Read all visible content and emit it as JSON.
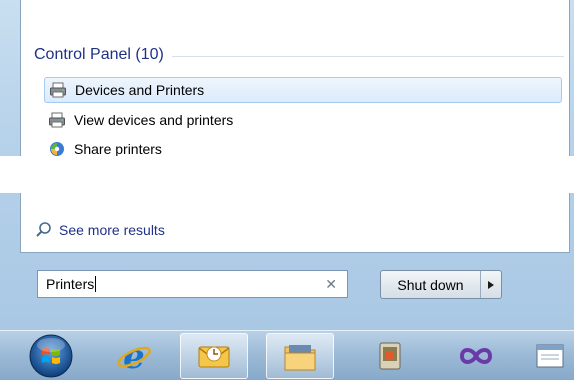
{
  "start_menu": {
    "group": {
      "title": "Control Panel (10)"
    },
    "results": [
      {
        "label": "Devices and Printers",
        "icon": "printer-icon",
        "selected": true
      },
      {
        "label": "View devices and printers",
        "icon": "printer-icon",
        "selected": false
      },
      {
        "label": "Share printers",
        "icon": "homegroup-icon",
        "selected": false
      }
    ],
    "see_more": {
      "label": "See more results",
      "icon": "search-icon"
    },
    "search": {
      "value": "Printers",
      "clear_icon": "clear-icon"
    },
    "shutdown": {
      "label": "Shut down",
      "arrow_icon": "arrow-right-icon"
    }
  },
  "taskbar": {
    "items": [
      {
        "name": "start-orb",
        "icon": "windows-orb-icon"
      },
      {
        "name": "internet-explorer",
        "icon": "internet-explorer-icon"
      },
      {
        "name": "outlook",
        "icon": "outlook-icon"
      },
      {
        "name": "windows-explorer",
        "icon": "folder-icon"
      },
      {
        "name": "app-5",
        "icon": "app-icon"
      },
      {
        "name": "visual-studio",
        "icon": "infinity-icon"
      },
      {
        "name": "app-7",
        "icon": "window-icon"
      }
    ]
  },
  "colors": {
    "accent_blue": "#1e3287",
    "selection_bg": "#dcebfc",
    "selection_border": "#a8caf0"
  }
}
